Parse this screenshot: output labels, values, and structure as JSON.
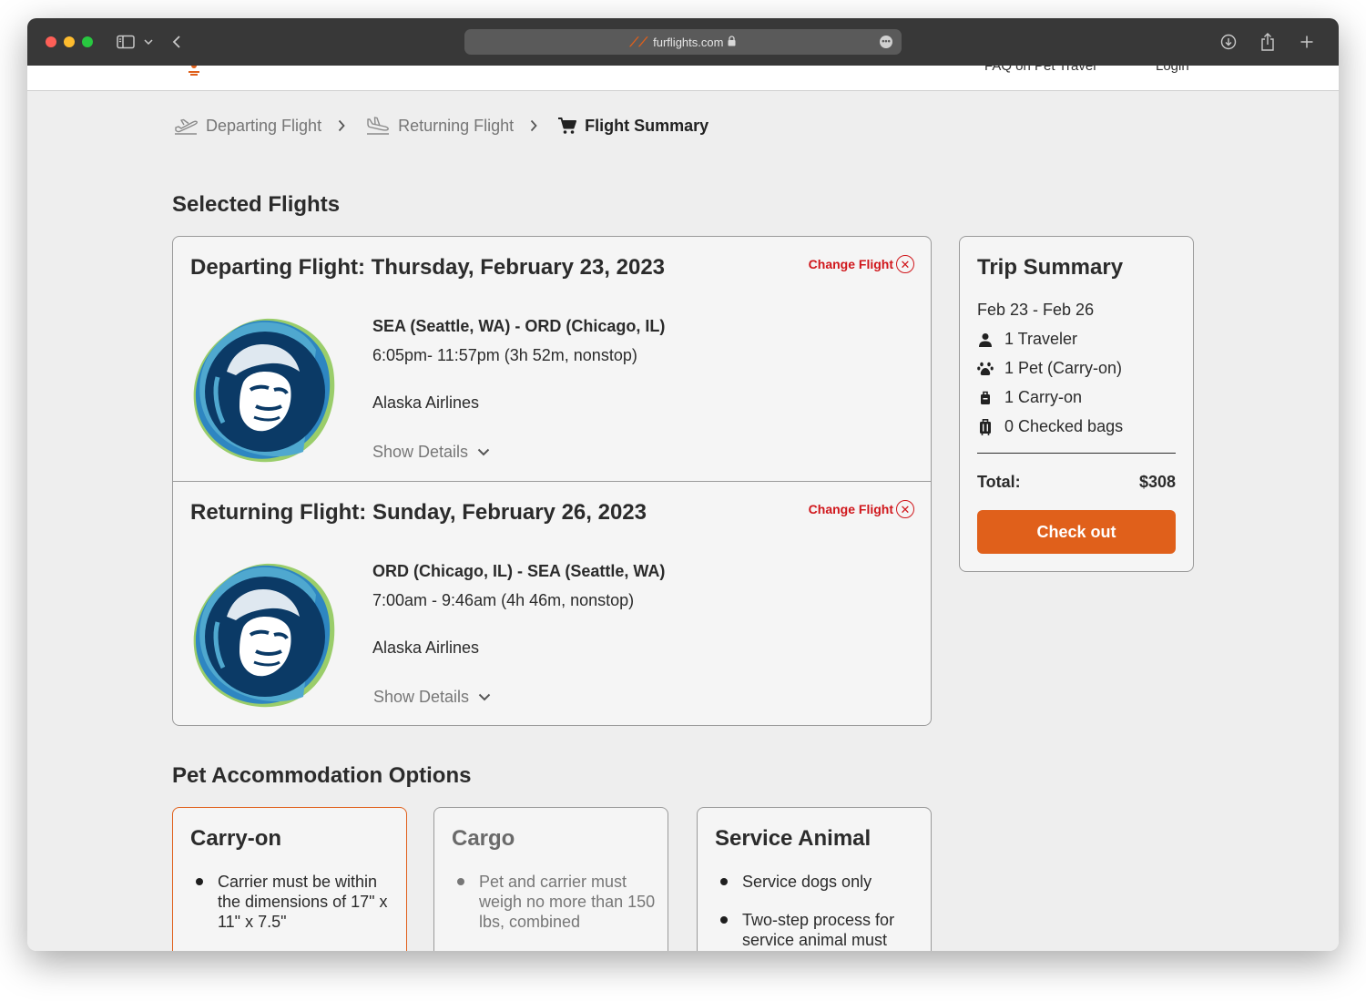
{
  "browser": {
    "url": "furflights.com"
  },
  "header": {
    "nav": [
      "FAQ on Pet Travel",
      "Login"
    ]
  },
  "breadcrumbs": [
    {
      "label": "Departing Flight",
      "icon": "plane-takeoff-icon"
    },
    {
      "label": "Returning Flight",
      "icon": "plane-landing-icon"
    },
    {
      "label": "Flight Summary",
      "icon": "cart-icon"
    }
  ],
  "selected_flights": {
    "title": "Selected Flights",
    "change_label": "Change Flight",
    "details_label": "Show Details",
    "flights": [
      {
        "heading": "Departing Flight: Thursday, February 23, 2023",
        "route": "SEA (Seattle, WA) - ORD (Chicago, IL)",
        "times": "6:05pm- 11:57pm (3h 52m, nonstop)",
        "airline": "Alaska Airlines"
      },
      {
        "heading": "Returning Flight: Sunday, February 26, 2023",
        "route": "ORD (Chicago, IL) - SEA (Seattle, WA)",
        "times": "7:00am - 9:46am (4h 46m, nonstop)",
        "airline": "Alaska Airlines"
      }
    ]
  },
  "trip_summary": {
    "title": "Trip Summary",
    "dates": "Feb 23 - Feb 26",
    "items": [
      {
        "label": "1 Traveler",
        "icon": "person-icon"
      },
      {
        "label": "1 Pet (Carry-on)",
        "icon": "paw-icon"
      },
      {
        "label": "1 Carry-on",
        "icon": "carry-on-bag-icon"
      },
      {
        "label": "0 Checked bags",
        "icon": "luggage-icon"
      }
    ],
    "total_label": "Total:",
    "total_value": "$308",
    "checkout_label": "Check out"
  },
  "pet_options": {
    "title": "Pet Accommodation Options",
    "cards": [
      {
        "title": "Carry-on",
        "items": [
          "Carrier must be within the dimensions of 17\" x 11\" x 7.5\""
        ]
      },
      {
        "title": "Cargo",
        "items": [
          "Pet and carrier must weigh no more than 150 lbs, combined"
        ]
      },
      {
        "title": "Service Animal",
        "items": [
          "Service dogs only",
          "Two-step process for service animal must"
        ]
      }
    ]
  },
  "colors": {
    "accent": "#e0601b",
    "danger": "#d0161b",
    "airline_navy": "#0b3a66"
  }
}
